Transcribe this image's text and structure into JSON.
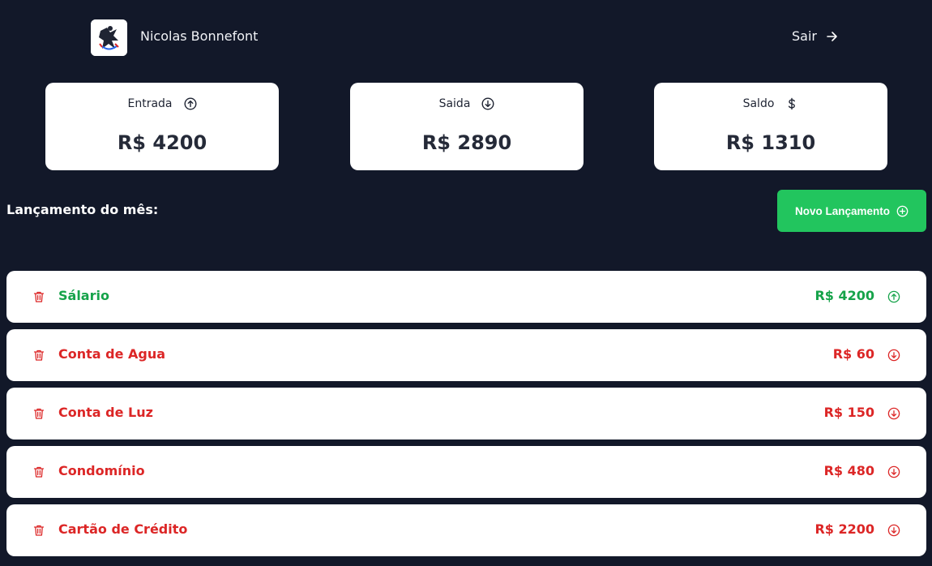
{
  "header": {
    "user_name": "Nicolas Bonnefont",
    "logout_label": "Sair"
  },
  "summary": {
    "income": {
      "label": "Entrada",
      "value": "R$ 4200",
      "icon": "arrow-up-circle-icon"
    },
    "expense": {
      "label": "Saida",
      "value": "R$ 2890",
      "icon": "arrow-down-circle-icon"
    },
    "balance": {
      "label": "Saldo",
      "value": "R$ 1310",
      "icon": "dollar-icon"
    }
  },
  "section": {
    "title": "Lançamento do mês:",
    "new_button_label": "Novo Lançamento"
  },
  "transactions": [
    {
      "description": "Sálario",
      "amount": "R$ 4200",
      "type": "income"
    },
    {
      "description": "Conta de Agua",
      "amount": "R$ 60",
      "type": "expense"
    },
    {
      "description": "Conta de Luz",
      "amount": "R$ 150",
      "type": "expense"
    },
    {
      "description": "Condomínio",
      "amount": "R$ 480",
      "type": "expense"
    },
    {
      "description": "Cartão de Crédito",
      "amount": "R$ 2200",
      "type": "expense"
    }
  ],
  "colors": {
    "background": "#121829",
    "income": "#16a34a",
    "expense": "#dc2626",
    "accent_button": "#22c55e"
  }
}
